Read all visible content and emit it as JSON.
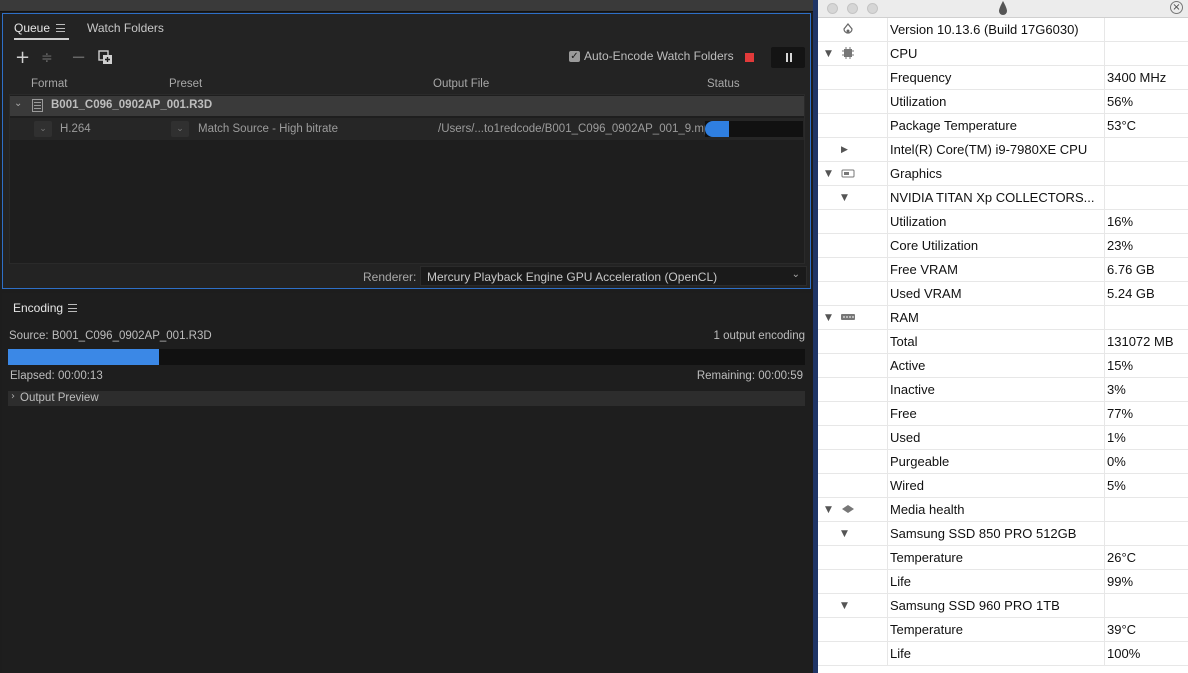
{
  "encoder": {
    "queue_tab": "Queue",
    "watch_tab": "Watch Folders",
    "auto_encode_label": "Auto-Encode Watch Folders",
    "columns": {
      "format": "Format",
      "preset": "Preset",
      "output": "Output File",
      "status": "Status"
    },
    "source_name": "B001_C096_0902AP_001.R3D",
    "output_item": {
      "format": "H.264",
      "preset": "Match Source - High bitrate",
      "output_file": "/Users/...to1redcode/B001_C096_0902AP_001_9.mp4",
      "progress": 0.24
    },
    "renderer_label": "Renderer:",
    "renderer_value": "Mercury Playback Engine GPU Acceleration (OpenCL)",
    "encoding_tab": "Encoding",
    "encoding_source": "Source: B001_C096_0902AP_001.R3D",
    "output_count": "1 output encoding",
    "encoding_progress": 0.19,
    "elapsed": "Elapsed: 00:00:13",
    "remaining": "Remaining: 00:00:59",
    "output_preview": "Output Preview"
  },
  "stats": {
    "rows": [
      {
        "level": 0,
        "icon": "istat-logo-icon",
        "disclosure": "",
        "label": "Version 10.13.6 (Build 17G6030)",
        "value": ""
      },
      {
        "level": 0,
        "icon": "cpu-icon",
        "disclosure": "▼",
        "label": "CPU",
        "value": ""
      },
      {
        "level": 1,
        "icon": "",
        "disclosure": "",
        "label": "Frequency",
        "value": "3400 MHz"
      },
      {
        "level": 1,
        "icon": "",
        "disclosure": "",
        "label": "Utilization",
        "value": "56%"
      },
      {
        "level": 1,
        "icon": "",
        "disclosure": "",
        "label": "Package Temperature",
        "value": "53°C"
      },
      {
        "level": 1,
        "icon": "",
        "disclosure": "▶",
        "label": "Intel(R) Core(TM) i9-7980XE CPU",
        "value": ""
      },
      {
        "level": 0,
        "icon": "gpu-icon",
        "disclosure": "▼",
        "label": "Graphics",
        "value": ""
      },
      {
        "level": 1,
        "icon": "",
        "disclosure": "▼",
        "label": "NVIDIA TITAN Xp COLLECTORS...",
        "value": ""
      },
      {
        "level": 2,
        "icon": "",
        "disclosure": "",
        "label": "Utilization",
        "value": "16%"
      },
      {
        "level": 2,
        "icon": "",
        "disclosure": "",
        "label": "Core Utilization",
        "value": "23%"
      },
      {
        "level": 2,
        "icon": "",
        "disclosure": "",
        "label": "Free VRAM",
        "value": "6.76 GB"
      },
      {
        "level": 2,
        "icon": "",
        "disclosure": "",
        "label": "Used VRAM",
        "value": "5.24 GB"
      },
      {
        "level": 0,
        "icon": "ram-icon",
        "disclosure": "▼",
        "label": "RAM",
        "value": ""
      },
      {
        "level": 1,
        "icon": "",
        "disclosure": "",
        "label": "Total",
        "value": "131072 MB"
      },
      {
        "level": 1,
        "icon": "",
        "disclosure": "",
        "label": "Active",
        "value": "15%"
      },
      {
        "level": 1,
        "icon": "",
        "disclosure": "",
        "label": "Inactive",
        "value": "3%"
      },
      {
        "level": 1,
        "icon": "",
        "disclosure": "",
        "label": "Free",
        "value": "77%"
      },
      {
        "level": 1,
        "icon": "",
        "disclosure": "",
        "label": "Used",
        "value": "1%"
      },
      {
        "level": 1,
        "icon": "",
        "disclosure": "",
        "label": "Purgeable",
        "value": "0%"
      },
      {
        "level": 1,
        "icon": "",
        "disclosure": "",
        "label": "Wired",
        "value": "5%"
      },
      {
        "level": 0,
        "icon": "disk-icon",
        "disclosure": "▼",
        "label": "Media health",
        "value": ""
      },
      {
        "level": 1,
        "icon": "",
        "disclosure": "▼",
        "label": "Samsung SSD 850 PRO 512GB",
        "value": ""
      },
      {
        "level": 2,
        "icon": "",
        "disclosure": "",
        "label": "Temperature",
        "value": "26°C"
      },
      {
        "level": 2,
        "icon": "",
        "disclosure": "",
        "label": "Life",
        "value": "99%"
      },
      {
        "level": 1,
        "icon": "",
        "disclosure": "▼",
        "label": "Samsung SSD 960 PRO 1TB",
        "value": ""
      },
      {
        "level": 2,
        "icon": "",
        "disclosure": "",
        "label": "Temperature",
        "value": "39°C"
      },
      {
        "level": 2,
        "icon": "",
        "disclosure": "",
        "label": "Life",
        "value": "100%"
      }
    ]
  },
  "colors": {
    "accent": "#2f7fe0",
    "stop": "#e23a3a",
    "panel_border": "#2e6fc7"
  }
}
